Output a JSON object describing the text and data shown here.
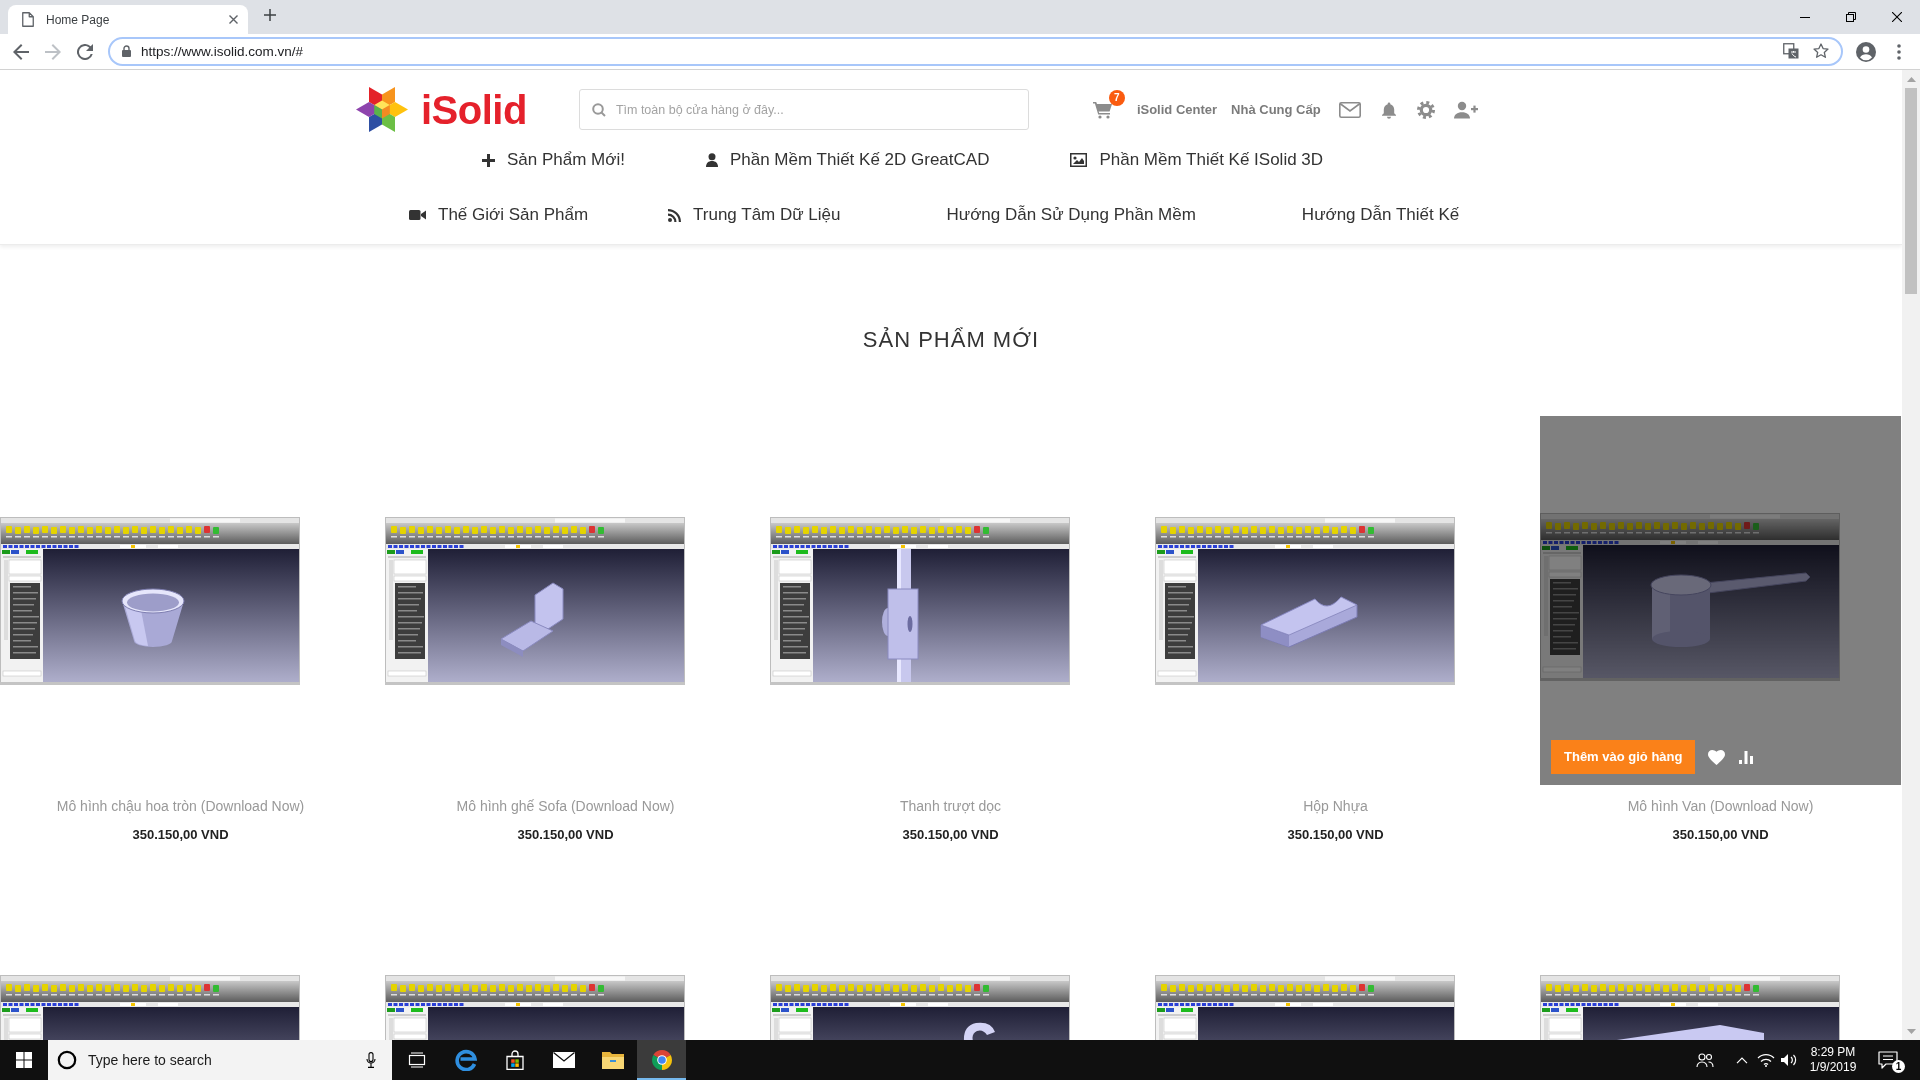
{
  "browser": {
    "tab_title": "Home Page",
    "url": "https://www.isolid.com.vn/#"
  },
  "header": {
    "logo_text": "iSolid",
    "search": {
      "placeholder": "Tìm toàn bộ cửa hàng ở đây..."
    },
    "cart_count": "7",
    "links": [
      "iSolid Center",
      "Nhà Cung Cấp"
    ]
  },
  "nav": [
    {
      "items": [
        {
          "label": "Sản Phẩm Mới!",
          "kind": "plus"
        },
        {
          "label": "Phần Mềm Thiết Kế 2D GreatCAD",
          "kind": "user"
        },
        {
          "label": "Phần Mềm Thiết Kế ISolid 3D",
          "kind": "image"
        }
      ]
    },
    {
      "items": [
        {
          "label": "Thế Giới Sản Phẩm",
          "kind": "video"
        },
        {
          "label": "Trung Tâm Dữ Liệu",
          "kind": "rss"
        },
        {
          "label": "Hướng Dẫn Sử Dụng Phần Mềm",
          "kind": "text"
        },
        {
          "label": "Hướng Dẫn Thiết Kế",
          "kind": "text"
        }
      ]
    }
  ],
  "section": {
    "title": "SẢN PHẨM MỚI",
    "add_to_cart": "Thêm vào giỏ hàng",
    "products": [
      {
        "kind": "bowl",
        "title": "Mô hình chậu hoa tròn (Download Now)",
        "price": "350.150,00 VND",
        "hovered": false
      },
      {
        "kind": "chair",
        "title": "Mô hình ghế Sofa (Download Now)",
        "price": "350.150,00 VND",
        "hovered": false
      },
      {
        "kind": "rod",
        "title": "Thanh trượt dọc",
        "price": "350.150,00 VND",
        "hovered": false
      },
      {
        "kind": "tray",
        "title": "Hộp Nhựa",
        "price": "350.150,00 VND",
        "hovered": false
      },
      {
        "kind": "ladle",
        "title": "Mô hình Van (Download Now)",
        "price": "350.150,00 VND",
        "hovered": true
      }
    ],
    "next_row": [
      {
        "kind": "empty"
      },
      {
        "kind": "empty"
      },
      {
        "kind": "hook"
      },
      {
        "kind": "empty"
      },
      {
        "kind": "plate"
      }
    ]
  },
  "taskbar": {
    "search": {
      "placeholder": "Type here to search"
    },
    "apps": [
      {
        "kind": "taskview",
        "active": false
      },
      {
        "kind": "edge",
        "active": false
      },
      {
        "kind": "store",
        "active": false
      },
      {
        "kind": "mail",
        "active": false
      },
      {
        "kind": "explorer",
        "active": false
      },
      {
        "kind": "chrome",
        "active": true
      }
    ],
    "time": "8:29 PM",
    "date": "1/9/2019",
    "notification_count": "1"
  }
}
